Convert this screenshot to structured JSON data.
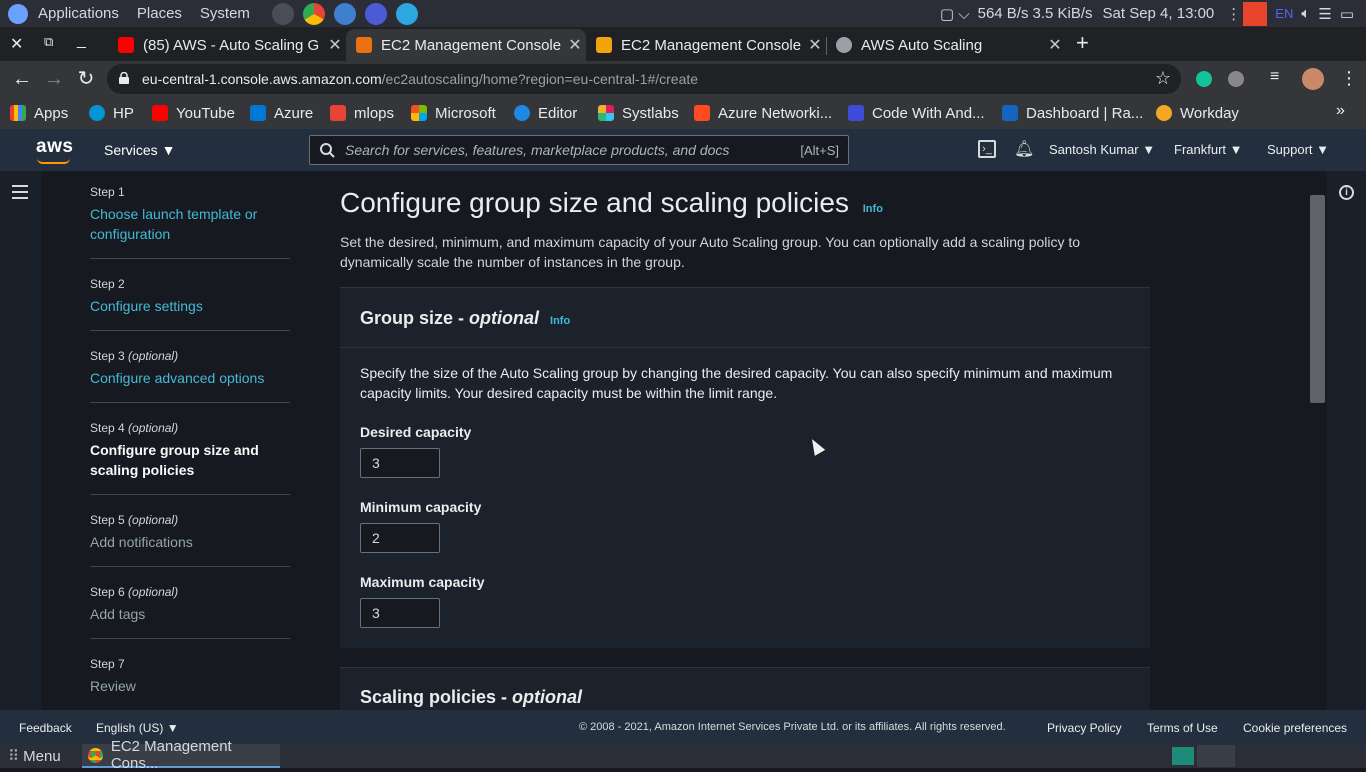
{
  "os": {
    "menu": [
      "Applications",
      "Places",
      "System"
    ],
    "net_down": "564 B/s",
    "net_up": "3.5 KiB/s",
    "datetime": "Sat Sep  4, 13:00",
    "lang": "EN"
  },
  "tabs": [
    {
      "title": "(85) AWS - Auto Scaling G",
      "active": false
    },
    {
      "title": "EC2 Management Console",
      "active": true
    },
    {
      "title": "EC2 Management Console",
      "active": false
    },
    {
      "title": "AWS Auto Scaling",
      "active": false
    }
  ],
  "url": {
    "host": "eu-central-1.console.aws.amazon.com",
    "path": "/ec2autoscaling/home?region=eu-central-1#/create"
  },
  "bookmarks": [
    "Apps",
    "HP",
    "YouTube",
    "Azure",
    "mlops",
    "Microsoft",
    "Editor",
    "Systlabs",
    "Azure Networki...",
    "Code With And...",
    "Dashboard | Ra...",
    "Workday"
  ],
  "awsnav": {
    "logo": "aws",
    "services": "Services",
    "search_placeholder": "Search for services, features, marketplace products, and docs",
    "search_shortcut": "[Alt+S]",
    "user": "Santosh Kumar",
    "region": "Frankfurt",
    "support": "Support"
  },
  "steps": [
    {
      "num": "Step 1",
      "optional": "",
      "title": "Choose launch template or configuration",
      "state": "link"
    },
    {
      "num": "Step 2",
      "optional": "",
      "title": "Configure settings",
      "state": "link"
    },
    {
      "num": "Step 3",
      "optional": "(optional)",
      "title": "Configure advanced options",
      "state": "link"
    },
    {
      "num": "Step 4",
      "optional": "(optional)",
      "title": "Configure group size and scaling policies",
      "state": "current"
    },
    {
      "num": "Step 5",
      "optional": "(optional)",
      "title": "Add notifications",
      "state": "disabled"
    },
    {
      "num": "Step 6",
      "optional": "(optional)",
      "title": "Add tags",
      "state": "disabled"
    },
    {
      "num": "Step 7",
      "optional": "",
      "title": "Review",
      "state": "disabled"
    }
  ],
  "page": {
    "title": "Configure group size and scaling policies",
    "info": "Info",
    "description": "Set the desired, minimum, and maximum capacity of your Auto Scaling group. You can optionally add a scaling policy to dynamically scale the number of instances in the group."
  },
  "group_size": {
    "heading": "Group size - ",
    "heading_italic": "optional",
    "info": "Info",
    "description": "Specify the size of the Auto Scaling group by changing the desired capacity. You can also specify minimum and maximum capacity limits. Your desired capacity must be within the limit range.",
    "desired_label": "Desired capacity",
    "desired_value": "3",
    "min_label": "Minimum capacity",
    "min_value": "2",
    "max_label": "Maximum capacity",
    "max_value": "3"
  },
  "scaling_policies": {
    "heading": "Scaling policies - ",
    "heading_italic": "optional"
  },
  "footer": {
    "feedback": "Feedback",
    "language": "English (US)",
    "copyright": "© 2008 - 2021, Amazon Internet Services Private Ltd. or its affiliates. All rights reserved.",
    "privacy": "Privacy Policy",
    "terms": "Terms of Use",
    "cookies": "Cookie preferences"
  },
  "taskbar": {
    "menu": "Menu",
    "window": "EC2 Management Cons..."
  }
}
